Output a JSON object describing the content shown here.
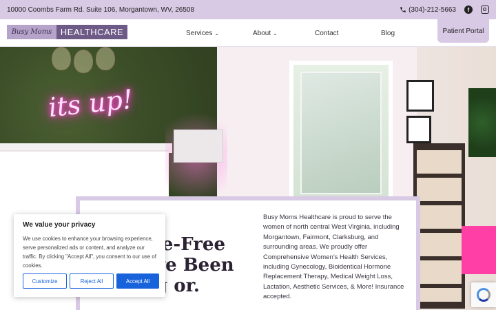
{
  "topbar": {
    "address": "10000 Coombs Farm Rd. Suite 106, Morgantown, WV, 26508",
    "phone": "(304)-212-5663",
    "social": [
      {
        "icon": "facebook-icon"
      },
      {
        "icon": "instagram-icon"
      }
    ]
  },
  "header": {
    "logo_script": "Busy Moms",
    "logo_word": "HEALTHCARE",
    "nav": {
      "services": "Services",
      "about": "About",
      "contact": "Contact",
      "blog": "Blog",
      "portal": "Patient Portal"
    }
  },
  "hero": {
    "neon_sign": "its up!",
    "heading_line1": "le-Free",
    "heading_line2": "ve Been",
    "heading_line3": "g   or.",
    "paragraph": "Busy Moms Healthcare is proud to serve the women of north central West Virginia, including Morgantown, Fairmont, Clarksburg, and surrounding areas. We proudly offer Comprehensive Women’s Health Services, including Gynecology, Bioidentical Hormone Replacement Therapy, Medical Weight Loss, Lactation, Aesthetic Services, & More! Insurance accepted."
  },
  "cookie_banner": {
    "title": "We value your privacy",
    "text": "We use cookies to enhance your browsing experience, serve personalized ads or content, and analyze our traffic. By clicking \"Accept All\", you consent to our use of cookies.",
    "customize": "Customize",
    "reject": "Reject All",
    "accept": "Accept All"
  },
  "colors": {
    "lavender": "#d8c9e4",
    "brand_purple": "#6e5a87",
    "cookie_blue": "#1863dc"
  }
}
